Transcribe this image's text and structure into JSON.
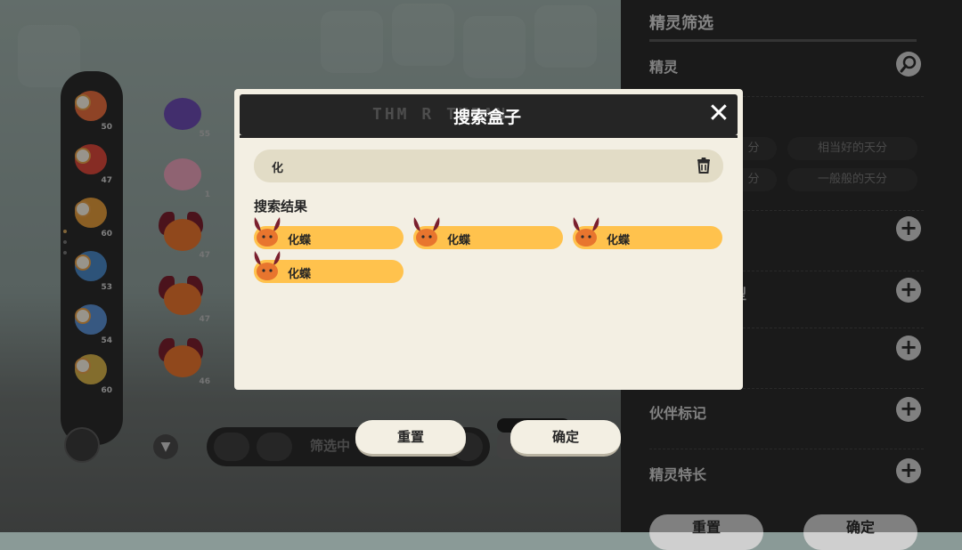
{
  "modal": {
    "title": "搜索盒子",
    "header_deco": "THM R         TXDAN",
    "close_glyph": "✕",
    "search": {
      "value": "化"
    },
    "results_label": "搜索结果",
    "results": [
      {
        "name": "化蝶"
      },
      {
        "name": "化蝶"
      },
      {
        "name": "化蝶"
      },
      {
        "name": "化蝶"
      }
    ]
  },
  "actions": {
    "reset_label": "重置",
    "confirm_label": "确定"
  },
  "right_panel": {
    "title": "精灵筛选",
    "row_spirit": "精灵",
    "talent_options": [
      "分",
      "相当好的天分",
      "分",
      "一般般的天分"
    ],
    "row_partial": "型",
    "row_partner_mark": "伙伴标记",
    "row_specialty": "精灵特长",
    "bottom_reset": "重置",
    "bottom_confirm": "确定"
  },
  "left_list": {
    "levels": [
      "50",
      "47",
      "60",
      "53",
      "54",
      "60"
    ]
  },
  "grid_levels": [
    "55",
    "1",
    "47",
    "47",
    "46"
  ],
  "bottom_bar": {
    "filter_text": "筛选中"
  },
  "colors": {
    "accent_result": "#ffc24d",
    "modal_bg": "#f3efe3",
    "header_bg": "#252525"
  },
  "icons": {
    "close": "close-icon",
    "trash": "trash-icon",
    "search": "search-icon",
    "plus": "plus-icon",
    "funnel": "filter-icon"
  }
}
